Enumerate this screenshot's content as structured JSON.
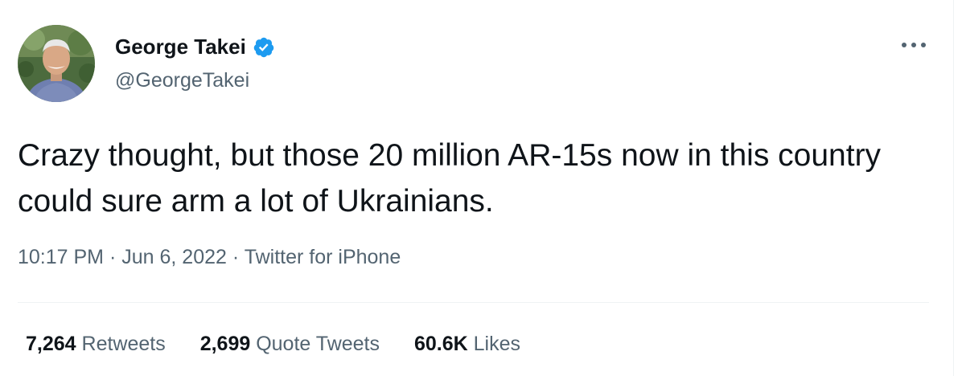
{
  "author": {
    "display_name": "George Takei",
    "handle": "@GeorgeTakei",
    "verified": true
  },
  "tweet": {
    "text": "Crazy thought, but those 20 million AR-15s now in this country could sure arm a lot of Ukrainians.",
    "time": "10:17 PM",
    "separator": "·",
    "date": "Jun 6, 2022",
    "source": "Twitter for iPhone"
  },
  "stats": {
    "retweets_count": "7,264",
    "retweets_label": "Retweets",
    "quotes_count": "2,699",
    "quotes_label": "Quote Tweets",
    "likes_count": "60.6K",
    "likes_label": "Likes"
  },
  "colors": {
    "primary_text": "#0f1419",
    "secondary_text": "#536471",
    "verified_blue": "#1d9bf0",
    "divider": "#eff3f4"
  },
  "icons": {
    "verified": "verified-badge-icon",
    "more": "more-horizontal-icon"
  }
}
